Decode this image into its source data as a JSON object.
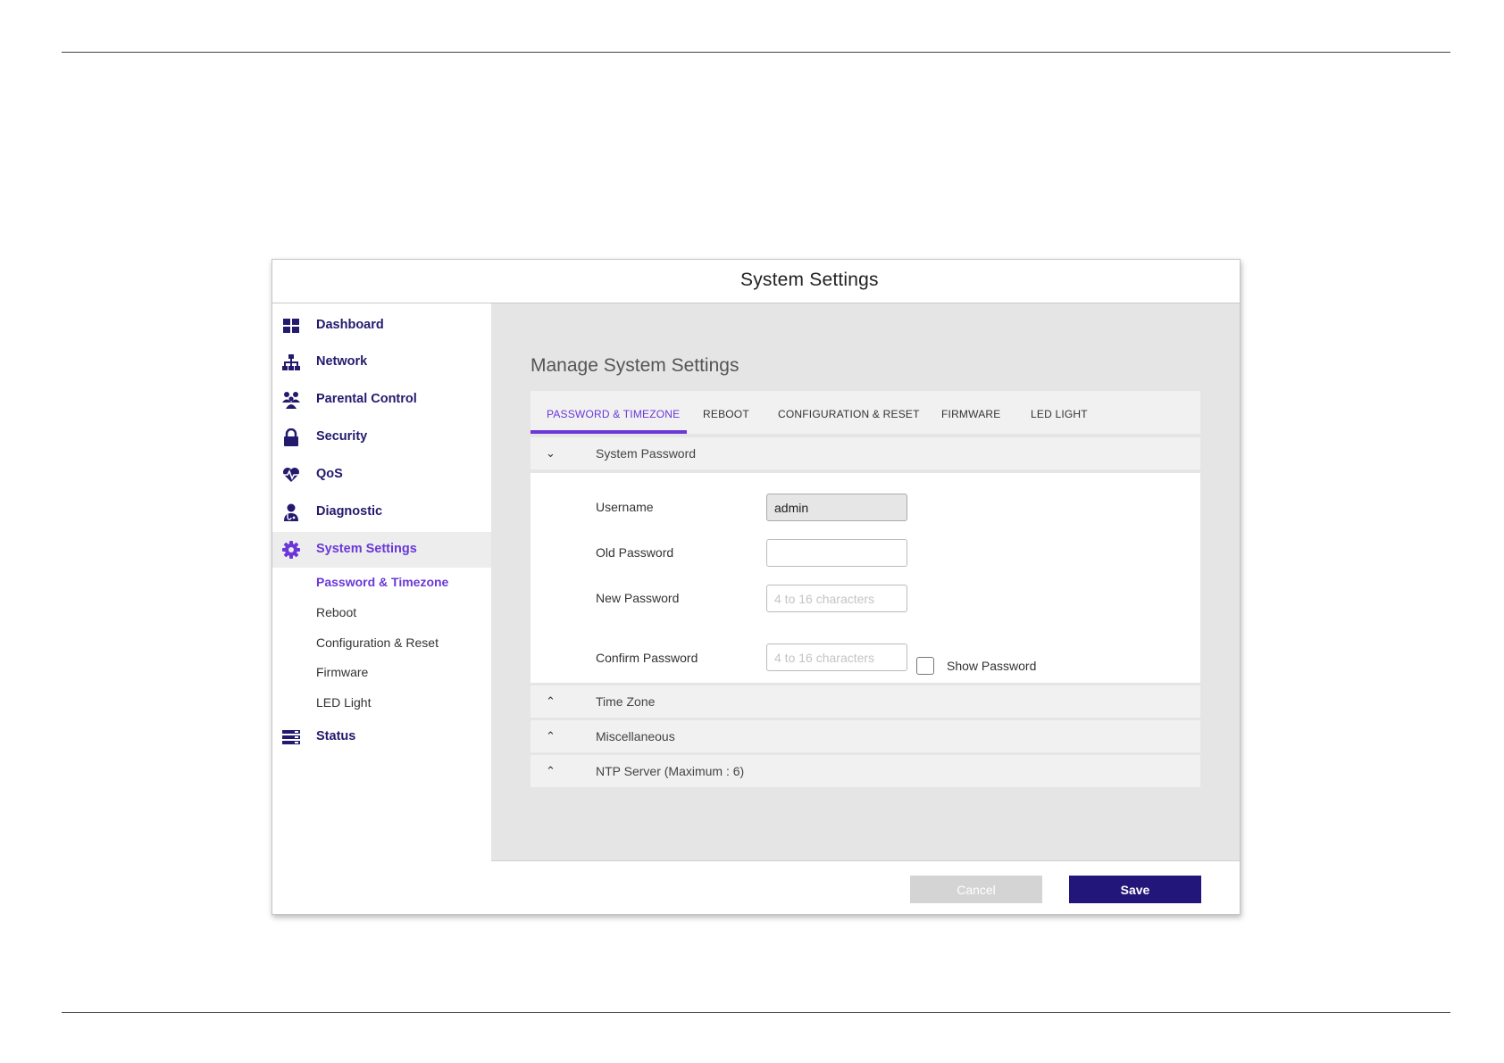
{
  "window": {
    "title": "System Settings"
  },
  "sidebar": {
    "items": [
      {
        "label": "Dashboard",
        "icon": "dashboard-grid-icon"
      },
      {
        "label": "Network",
        "icon": "network-tree-icon"
      },
      {
        "label": "Parental Control",
        "icon": "family-icon"
      },
      {
        "label": "Security",
        "icon": "lock-icon"
      },
      {
        "label": "QoS",
        "icon": "heartbeat-icon"
      },
      {
        "label": "Diagnostic",
        "icon": "doctor-icon"
      },
      {
        "label": "System Settings",
        "icon": "gear-icon",
        "active": true
      },
      {
        "label": "Status",
        "icon": "status-list-icon"
      }
    ],
    "subitems": [
      {
        "label": "Password & Timezone",
        "active": true
      },
      {
        "label": "Reboot"
      },
      {
        "label": "Configuration & Reset"
      },
      {
        "label": "Firmware"
      },
      {
        "label": "LED Light"
      }
    ]
  },
  "main": {
    "title": "Manage System Settings",
    "tabs": [
      {
        "label": "PASSWORD & TIMEZONE",
        "active": true
      },
      {
        "label": "REBOOT"
      },
      {
        "label": "CONFIGURATION & RESET"
      },
      {
        "label": "FIRMWARE"
      },
      {
        "label": "LED LIGHT"
      }
    ],
    "sections": [
      {
        "label": "System Password",
        "expanded": true
      },
      {
        "label": "Time Zone",
        "expanded": false
      },
      {
        "label": "Miscellaneous",
        "expanded": false
      },
      {
        "label": "NTP Server (Maximum : 6)",
        "expanded": false
      }
    ],
    "form": {
      "username_label": "Username",
      "username_value": "admin",
      "old_password_label": "Old Password",
      "old_password_value": "",
      "new_password_label": "New Password",
      "new_password_placeholder": "4 to 16 characters",
      "confirm_password_label": "Confirm Password",
      "confirm_password_placeholder": "4 to 16 characters",
      "show_password_label": "Show Password",
      "show_password_checked": false
    }
  },
  "footer": {
    "cancel_label": "Cancel",
    "save_label": "Save"
  },
  "colors": {
    "accent": "#6a38d8",
    "brand": "#23167a",
    "nav_text": "#231a6e"
  }
}
